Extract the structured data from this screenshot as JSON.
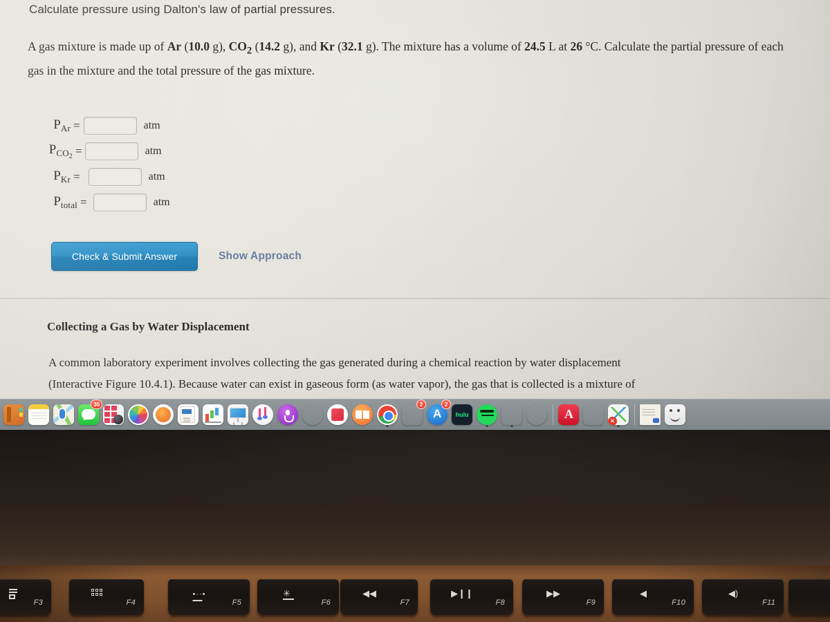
{
  "question": {
    "header": "Calculate pressure using Dalton's law of partial pressures.",
    "body_parts": [
      {
        "text": "A gas mixture is made up of ",
        "bold": false
      },
      {
        "text": "Ar",
        "bold": true
      },
      {
        "text": " (",
        "bold": false
      },
      {
        "text": "10.0",
        "bold": true
      },
      {
        "text": " g), ",
        "bold": false
      },
      {
        "text": "CO",
        "bold": true
      },
      {
        "text": "2",
        "bold": true,
        "sub": true
      },
      {
        "text": " (",
        "bold": false
      },
      {
        "text": "14.2",
        "bold": true
      },
      {
        "text": " g), and ",
        "bold": false
      },
      {
        "text": "Kr",
        "bold": true
      },
      {
        "text": " (",
        "bold": false
      },
      {
        "text": "32.1",
        "bold": true
      },
      {
        "text": " g). The mixture has a volume of ",
        "bold": false
      },
      {
        "text": "24.5",
        "bold": true
      },
      {
        "text": " L at ",
        "bold": false
      },
      {
        "text": "26",
        "bold": true
      },
      {
        "text": " °C. Calculate the partial pressure of each gas in the mixture and the total pressure of the gas mixture.",
        "bold": false
      }
    ],
    "full_text": "A gas mixture is made up of Ar (10.0 g), CO2 (14.2 g), and Kr (32.1 g). The mixture has a volume of 24.5 L at 26 °C. Calculate the partial pressure of each gas in the mixture and the total pressure of the gas mixture."
  },
  "answers": {
    "rows": [
      {
        "symbol": "P",
        "subscript": "Ar",
        "sub_sub": "",
        "equals": "=",
        "value": "",
        "placeholder": "",
        "unit": "atm"
      },
      {
        "symbol": "P",
        "subscript": "CO",
        "sub_sub": "2",
        "equals": "=",
        "value": "",
        "placeholder": "",
        "unit": "atm"
      },
      {
        "symbol": "P",
        "subscript": "Kr",
        "sub_sub": "",
        "equals": "=",
        "value": "",
        "placeholder": "",
        "unit": "atm"
      },
      {
        "symbol": "P",
        "subscript": "total",
        "sub_sub": "",
        "equals": "=",
        "value": "",
        "placeholder": "",
        "unit": "atm"
      }
    ]
  },
  "actions": {
    "submit_label": "Check & Submit Answer",
    "show_approach_label": "Show Approach",
    "submit_color": "#2f8fc4",
    "link_color": "#6c7da0"
  },
  "section": {
    "title": "Collecting a Gas by Water Displacement",
    "line1": "A common laboratory experiment involves collecting the gas generated during a chemical reaction by water displacement",
    "line2": "(Interactive Figure 10.4.1). Because water can exist in gaseous form (as water vapor), the gas that is collected is a mixture of"
  },
  "dock": {
    "items": [
      {
        "name": "contacts",
        "label": "Contacts",
        "badge": "",
        "running": false
      },
      {
        "name": "notes",
        "label": "Notes",
        "badge": "",
        "running": false
      },
      {
        "name": "maps",
        "label": "Maps",
        "badge": "",
        "running": false
      },
      {
        "name": "messages",
        "label": "Messages",
        "badge": "30",
        "running": false
      },
      {
        "name": "photo-booth",
        "label": "Photo Booth",
        "badge": "",
        "running": false
      },
      {
        "name": "photos",
        "label": "Photos",
        "badge": "",
        "running": false
      },
      {
        "name": "app-store-1",
        "label": "App Store",
        "badge": "",
        "running": false
      },
      {
        "name": "pages",
        "label": "Pages",
        "badge": "",
        "running": false
      },
      {
        "name": "numbers",
        "label": "Numbers",
        "badge": "",
        "running": false
      },
      {
        "name": "keynote",
        "label": "Keynote",
        "badge": "",
        "running": false
      },
      {
        "name": "itunes",
        "label": "iTunes",
        "badge": "",
        "running": false
      },
      {
        "name": "podcasts",
        "label": "Podcasts",
        "badge": "",
        "running": false
      },
      {
        "name": "apple-tv",
        "label": "Apple TV",
        "badge": "",
        "running": false
      },
      {
        "name": "news",
        "label": "News",
        "badge": "",
        "running": false
      },
      {
        "name": "books",
        "label": "Books",
        "badge": "",
        "running": false
      },
      {
        "name": "chrome",
        "label": "Google Chrome",
        "badge": "",
        "running": true
      },
      {
        "name": "system-preferences",
        "label": "System Preferences",
        "badge": "2",
        "running": false
      },
      {
        "name": "app-store-2",
        "label": "App Store",
        "badge": "2",
        "running": false
      },
      {
        "name": "hulu",
        "label": "hulu",
        "badge": "",
        "running": false
      },
      {
        "name": "spotify",
        "label": "Spotify",
        "badge": "",
        "running": true
      },
      {
        "name": "microsoft-word",
        "label": "Microsoft Word",
        "badge": "",
        "running": true
      },
      {
        "name": "powerpoint",
        "label": "Microsoft PowerPoint",
        "badge": "",
        "running": false
      },
      {
        "name": "separator-1",
        "label": "",
        "badge": "",
        "running": false
      },
      {
        "name": "acrobat",
        "label": "Adobe Acrobat",
        "badge": "",
        "running": false
      },
      {
        "name": "flash-player",
        "label": "Flash Player",
        "badge": "",
        "running": false
      },
      {
        "name": "connect",
        "label": "Connect",
        "badge": "",
        "running": true
      },
      {
        "name": "separator-2",
        "label": "",
        "badge": "",
        "running": false
      },
      {
        "name": "stickies",
        "label": "Stickies",
        "badge": "",
        "running": false
      },
      {
        "name": "finder",
        "label": "Finder",
        "badge": "",
        "running": false
      }
    ]
  },
  "keyboard": {
    "keys": [
      {
        "label": "F3",
        "glyph": "mission-control",
        "partial": "left"
      },
      {
        "label": "F4",
        "glyph": "launchpad",
        "partial": ""
      },
      {
        "label": "F5",
        "glyph": "keyboard-backlight-down",
        "partial": ""
      },
      {
        "label": "F6",
        "glyph": "keyboard-backlight-up",
        "partial": ""
      },
      {
        "label": "F7",
        "glyph": "rewind",
        "partial": ""
      },
      {
        "label": "F8",
        "glyph": "play-pause",
        "partial": ""
      },
      {
        "label": "F9",
        "glyph": "fast-forward",
        "partial": ""
      },
      {
        "label": "F10",
        "glyph": "mute",
        "partial": ""
      },
      {
        "label": "F11",
        "glyph": "volume-down",
        "partial": ""
      },
      {
        "label": "",
        "glyph": "",
        "partial": "right"
      }
    ]
  }
}
